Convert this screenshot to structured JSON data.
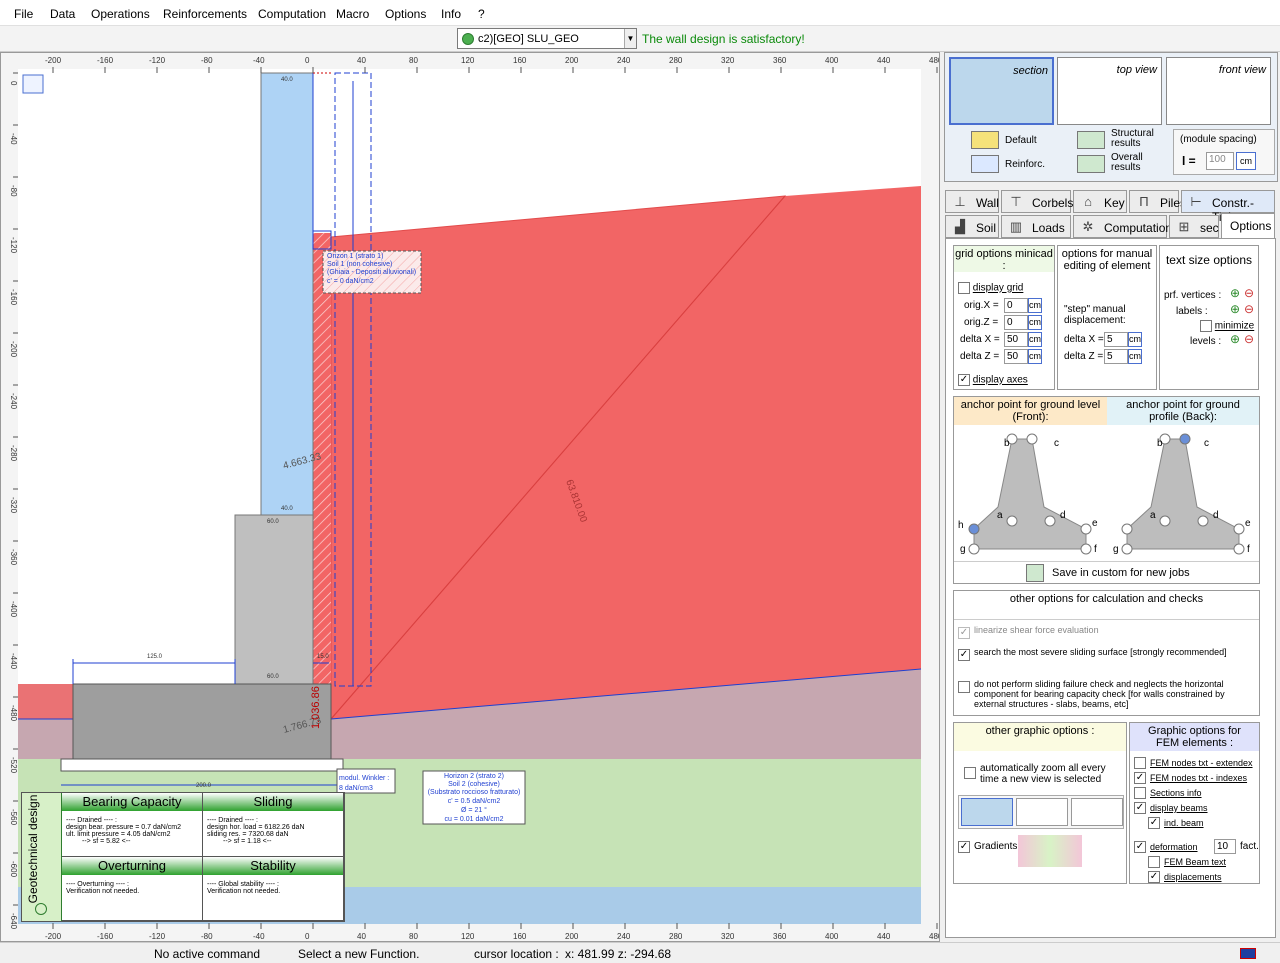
{
  "menu": [
    "File",
    "Data",
    "Operations",
    "Reinforcements",
    "Computation",
    "Macro",
    "Options",
    "Info",
    "?"
  ],
  "combo": {
    "value": "c2)[GEO] SLU_GEO"
  },
  "status_message": "The wall design is satisfactory!",
  "status_color": "#0a8a0a",
  "axis": {
    "top_ticks": [
      "-200",
      "-160",
      "-120",
      "-80",
      "-40",
      "0",
      "40",
      "80",
      "120",
      "160",
      "200",
      "240",
      "280",
      "320",
      "360",
      "400",
      "440",
      "480"
    ],
    "left_ticks": [
      "0",
      "-40",
      "-80",
      "-120",
      "-160",
      "-200",
      "-240",
      "-280",
      "-320",
      "-360",
      "-400",
      "-440",
      "-480",
      "-520",
      "-560",
      "-600",
      "-640"
    ]
  },
  "drawing": {
    "soil1_label": [
      "Orizon 1 (strato 1)",
      "Soil 1 (non cohesive)",
      "(Ghiaia - Depositi alluvionali)",
      "c' = 0 daN/cm2"
    ],
    "soil2_label": [
      "Horizon 2 (strato 2)",
      "Soil 2 (cohesive)",
      "(Substrato roccioso fratturato)",
      "c' = 0.5 daN/cm2",
      "Ø = 21 °",
      "cu = 0.01 daN/cm2"
    ],
    "winkler_label": [
      "modul. Winkler :",
      "8 daN/cm3"
    ],
    "dim_labels": [
      "40.0",
      "40.0",
      "60.0",
      "60.0",
      "125.0",
      "15.0",
      "200.0",
      "4.663.33",
      "1.766.73",
      "1.036.86",
      "63.810.00"
    ],
    "colors": {
      "soil_fill": "#f26565",
      "stem_fill": "#aed3f5",
      "ground_front": "#c6a7b0",
      "ground_lower": "#c6e3b6",
      "water": "#a9cbe8",
      "concrete": "#9e9e9e"
    }
  },
  "geo": {
    "title": "Geotechnical design",
    "cards": [
      {
        "title": "Bearing Capacity",
        "lines": [
          "---- Drained ---- :",
          "design bear. pressure = 0.7 daN/cm2",
          "ult. limit pressure = 4.05 daN/cm2",
          "--> sf = 5.82 <--"
        ]
      },
      {
        "title": "Sliding",
        "lines": [
          "---- Drained ---- :",
          "design hor. load = 6182.26 daN",
          "sliding res. = 7320.68 daN",
          "--> sf = 1.18 <--"
        ]
      },
      {
        "title": "Overturning",
        "lines": [
          "---- Overturning ---- :",
          "Verification not needed."
        ]
      },
      {
        "title": "Stability",
        "lines": [
          "---- Global stability ---- :",
          "Verification not needed."
        ]
      }
    ]
  },
  "views": [
    {
      "label": "section"
    },
    {
      "label": "top view"
    },
    {
      "label": "front view"
    }
  ],
  "result_buttons": [
    "Default",
    "Reinforc.",
    "Structural results",
    "Overall results"
  ],
  "module_spacing": {
    "title": "(module spacing)",
    "l_label": "l =",
    "value": "100",
    "unit": "cm"
  },
  "tabs_row1": [
    "Wall",
    "Corbels",
    "Key",
    "Piles",
    "Constr.-Tieb."
  ],
  "tabs_row2": [
    "Soil",
    "Loads",
    "Computation",
    "sec",
    "Options"
  ],
  "grid_options": {
    "title": "grid options minicad :",
    "display_grid": "display grid",
    "rows": [
      {
        "label": "orig.X =",
        "value": "0",
        "unit": "cm"
      },
      {
        "label": "orig.Z =",
        "value": "0",
        "unit": "cm"
      },
      {
        "label": "delta X =",
        "value": "50",
        "unit": "cm"
      },
      {
        "label": "delta Z =",
        "value": "50",
        "unit": "cm"
      }
    ],
    "display_axes": "display axes"
  },
  "manual_options": {
    "title": "options for manual editing of element",
    "step": "\"step\" manual displacement:",
    "rows": [
      {
        "label": "delta X =",
        "value": "5",
        "unit": "cm"
      },
      {
        "label": "delta Z =",
        "value": "5",
        "unit": "cm"
      }
    ]
  },
  "text_size": {
    "title": "text size options",
    "vertices": "prf. vertices :",
    "labels": "labels :",
    "minimize": "minimize",
    "levels": "levels :"
  },
  "anchor": {
    "front": "anchor point for ground level (Front):",
    "back": "anchor point for ground profile (Back):",
    "points": [
      "b",
      "c",
      "a",
      "d",
      "h",
      "e",
      "g",
      "f"
    ],
    "save": "Save in custom for new jobs"
  },
  "other_calc": {
    "title": "other options for calculation and checks",
    "items": [
      {
        "text": "linearize shear force evaluation",
        "checked": true
      },
      {
        "text": "search the most severe sliding surface [strongly recommended]",
        "checked": true
      },
      {
        "text": "do not perform sliding failure check and neglects the horizontal component for bearing capacity check [for walls constrained by external structures - slabs, beams, etc]",
        "checked": false
      }
    ]
  },
  "other_graphic": {
    "title": "other graphic options :",
    "zoom": "automatically zoom all every time a new view is selected",
    "gradients": "Gradients"
  },
  "fem": {
    "title": "Graphic options for FEM elements :",
    "items": [
      {
        "text": "FEM nodes txt - extendex",
        "checked": false
      },
      {
        "text": "FEM nodes txt - indexes",
        "checked": true
      },
      {
        "text": "Sections info",
        "checked": false
      },
      {
        "text": "display beams",
        "checked": true
      },
      {
        "text": "ind. beam",
        "checked": true
      },
      {
        "text": "deformation",
        "checked": true
      },
      {
        "text": "FEM Beam text",
        "checked": false
      },
      {
        "text": "displacements",
        "checked": true
      }
    ],
    "fact_value": "10",
    "fact_label": "fact."
  },
  "statusbar": {
    "command": "No active command",
    "prompt": "Select a new Function.",
    "cursor_label": "cursor location :",
    "cursor": "x: 481.99  z: -294.68"
  }
}
